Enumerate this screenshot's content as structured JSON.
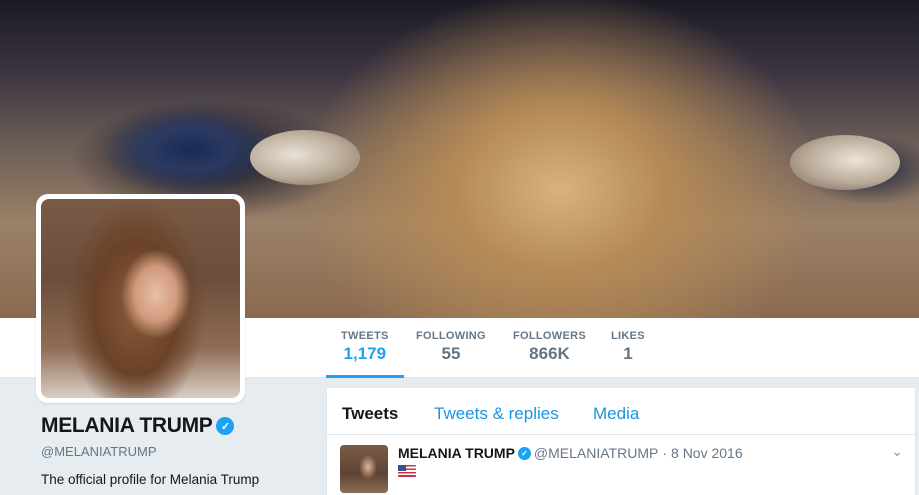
{
  "stats": [
    {
      "label": "TWEETS",
      "value": "1,179",
      "active": true
    },
    {
      "label": "FOLLOWING",
      "value": "55",
      "active": false
    },
    {
      "label": "FOLLOWERS",
      "value": "866K",
      "active": false
    },
    {
      "label": "LIKES",
      "value": "1",
      "active": false
    }
  ],
  "profile": {
    "name": "MELANIA TRUMP",
    "handle": "@MELANIATRUMP",
    "bio": "The official profile for Melania Trump"
  },
  "tabs": [
    {
      "label": "Tweets",
      "active": true
    },
    {
      "label": "Tweets & replies",
      "active": false
    },
    {
      "label": "Media",
      "active": false
    }
  ],
  "tweet": {
    "name": "MELANIA TRUMP",
    "handle": "@MELANIATRUMP",
    "separator": "·",
    "date": "8 Nov 2016",
    "flag_icon": "us-flag-icon"
  },
  "colors": {
    "accent": "#1da1f2",
    "link": "#1b95e0",
    "muted": "#657786"
  }
}
